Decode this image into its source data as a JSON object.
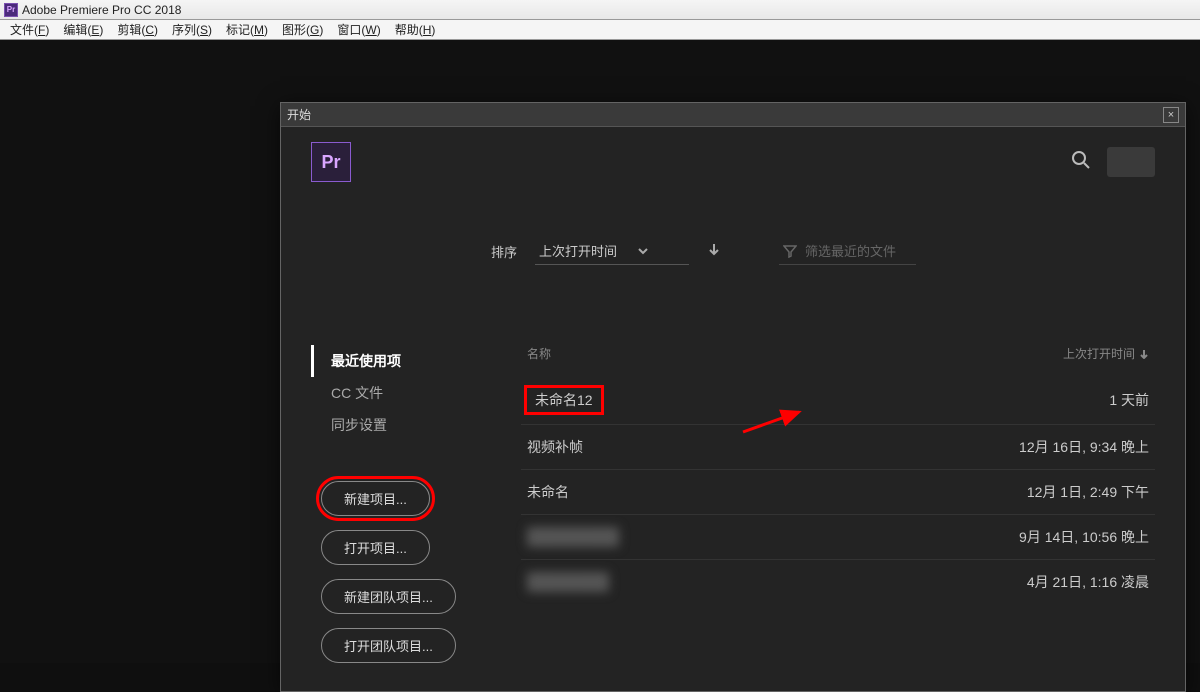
{
  "app": {
    "title": "Adobe Premiere Pro CC 2018",
    "icon_text": "Pr"
  },
  "menu": [
    {
      "lbl": "文件",
      "key": "F"
    },
    {
      "lbl": "编辑",
      "key": "E"
    },
    {
      "lbl": "剪辑",
      "key": "C"
    },
    {
      "lbl": "序列",
      "key": "S"
    },
    {
      "lbl": "标记",
      "key": "M"
    },
    {
      "lbl": "图形",
      "key": "G"
    },
    {
      "lbl": "窗口",
      "key": "W"
    },
    {
      "lbl": "帮助",
      "key": "H"
    }
  ],
  "start": {
    "title": "开始",
    "logo_text": "Pr",
    "sort_label": "排序",
    "sort_value": "上次打开时间",
    "filter_placeholder": "筛选最近的文件",
    "nav": [
      {
        "label": "最近使用项",
        "active": true
      },
      {
        "label": "CC 文件",
        "active": false
      },
      {
        "label": "同步设置",
        "active": false
      }
    ],
    "buttons": [
      {
        "label": "新建项目...",
        "highlight": true
      },
      {
        "label": "打开项目...",
        "highlight": false
      },
      {
        "label": "新建团队项目...",
        "highlight": false
      },
      {
        "label": "打开团队项目...",
        "highlight": false
      }
    ],
    "columns": {
      "name": "名称",
      "time": "上次打开时间"
    },
    "rows": [
      {
        "name": "未命名12",
        "time": "1 天前",
        "hl": true
      },
      {
        "name": "视频补帧",
        "time": "12月 16日, 9:34 晚上"
      },
      {
        "name": "未命名",
        "time": "12月 1日, 2:49 下午"
      },
      {
        "name": "████",
        "time": "9月 14日, 10:56 晚上",
        "blur": true
      },
      {
        "name": "███",
        "time": "4月 21日, 1:16 凌晨",
        "blur": true
      }
    ]
  }
}
